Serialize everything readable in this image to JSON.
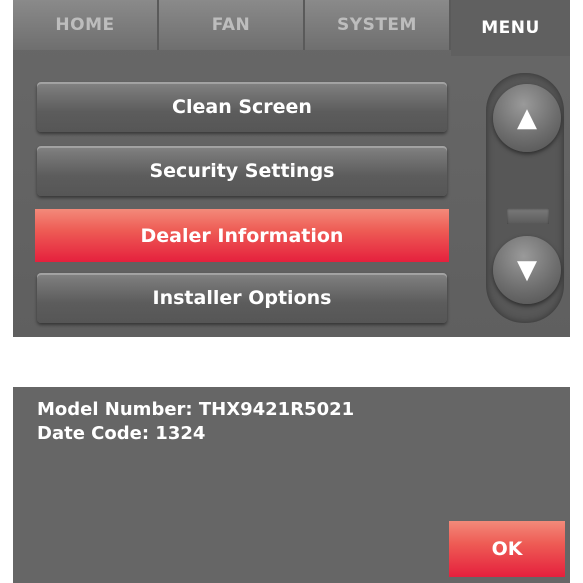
{
  "tabs": {
    "home": "HOME",
    "fan": "FAN",
    "system": "SYSTEM",
    "menu": "MENU",
    "active": "MENU"
  },
  "menu_items": [
    {
      "label": "Clean Screen",
      "selected": false
    },
    {
      "label": "Security Settings",
      "selected": false
    },
    {
      "label": "Dealer Information",
      "selected": true
    },
    {
      "label": "Installer Options",
      "selected": false
    }
  ],
  "scroll": {
    "up_icon": "up-arrow-icon",
    "up_glyph": "▲",
    "down_icon": "down-arrow-icon",
    "down_glyph": "▼"
  },
  "dealer_info": {
    "model_number": "Model Number: THX9421R5021",
    "date_code": "Date Code: 1324",
    "ok_label": "OK"
  },
  "colors": {
    "panel": "#666666",
    "selected_accent": "#e5203d",
    "text": "#ffffff",
    "inactive_tab_text": "#bdbdbd"
  }
}
